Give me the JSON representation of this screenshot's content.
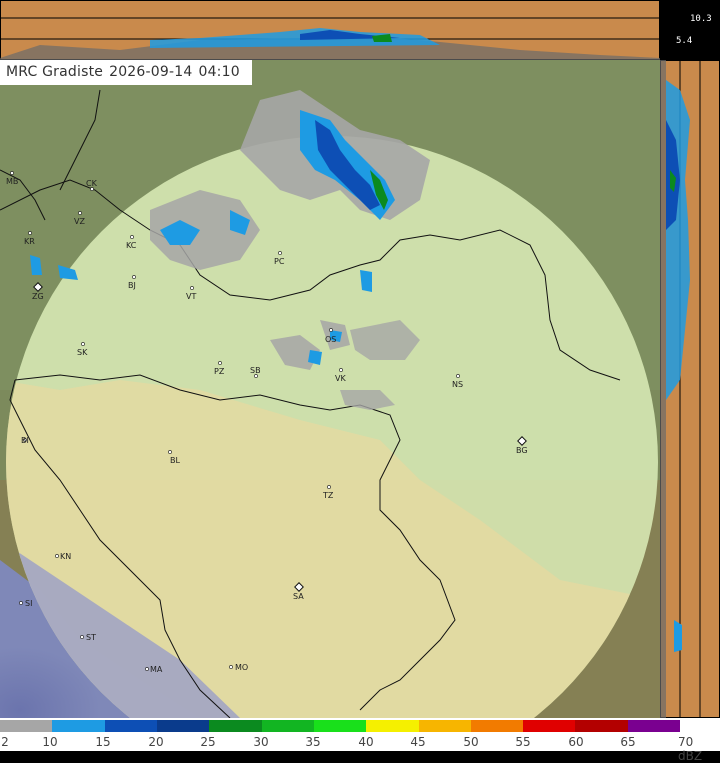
{
  "header": {
    "station": "MRC Gradiste",
    "date": "2026-09-14",
    "time": "04:10"
  },
  "profile_scale": {
    "upper": "10.3",
    "lower": "5.4"
  },
  "cities": [
    {
      "code": "MB",
      "kind": "dot"
    },
    {
      "code": "CK",
      "kind": "dot"
    },
    {
      "code": "VZ",
      "kind": "dot"
    },
    {
      "code": "KR",
      "kind": "dot"
    },
    {
      "code": "KC",
      "kind": "dot"
    },
    {
      "code": "PC",
      "kind": "dot"
    },
    {
      "code": "BJ",
      "kind": "dot"
    },
    {
      "code": "ZG",
      "kind": "capital"
    },
    {
      "code": "VT",
      "kind": "dot"
    },
    {
      "code": "SK",
      "kind": "dot"
    },
    {
      "code": "OS",
      "kind": "dot"
    },
    {
      "code": "PZ",
      "kind": "dot"
    },
    {
      "code": "SB",
      "kind": "dot"
    },
    {
      "code": "VK",
      "kind": "dot"
    },
    {
      "code": "NS",
      "kind": "dot"
    },
    {
      "code": "BI",
      "kind": "dot"
    },
    {
      "code": "BL",
      "kind": "dot"
    },
    {
      "code": "BG",
      "kind": "capital"
    },
    {
      "code": "TZ",
      "kind": "dot"
    },
    {
      "code": "KN",
      "kind": "dot"
    },
    {
      "code": "SA",
      "kind": "capital"
    },
    {
      "code": "SI",
      "kind": "dot"
    },
    {
      "code": "ST",
      "kind": "dot"
    },
    {
      "code": "MA",
      "kind": "dot"
    },
    {
      "code": "MO",
      "kind": "dot"
    }
  ],
  "legend": {
    "colors": [
      "#a6a6a6",
      "#a6a6a6",
      "#1e9be3",
      "#1e9be3",
      "#0d4fb5",
      "#0d4fb5",
      "#0a3b8c",
      "#0a3b8c",
      "#0b8a1f",
      "#0b8a1f",
      "#12b522",
      "#12b522",
      "#19e01b",
      "#19e01b",
      "#f5f000",
      "#f5f000",
      "#f7b500",
      "#f7b500",
      "#f27b00",
      "#f27b00",
      "#e00000",
      "#e00000",
      "#b30000",
      "#b30000",
      "#7a0090",
      "#7a0090"
    ],
    "labels": [
      "2",
      "10",
      "15",
      "20",
      "25",
      "30",
      "35",
      "40",
      "45",
      "50",
      "55",
      "60",
      "65",
      "70 dBZ"
    ]
  },
  "colors": {
    "coverage": "#dcedb8",
    "outside": "#7a8f5a",
    "border": "#111111",
    "profile_bg": "#c98a4c"
  }
}
